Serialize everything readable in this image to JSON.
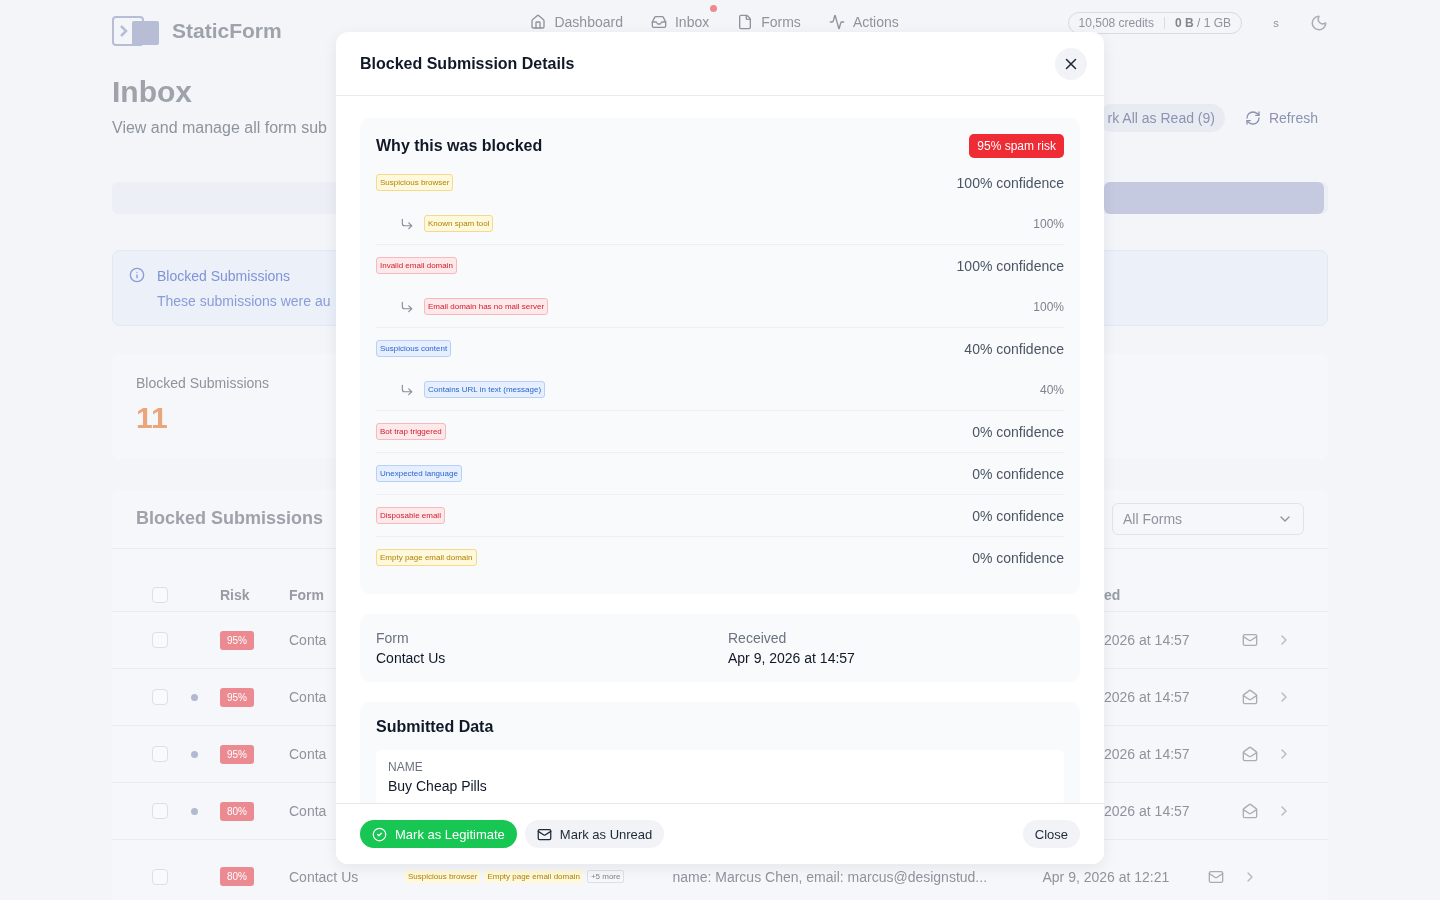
{
  "header": {
    "logo": "StaticForm",
    "nav": [
      {
        "label": "Dashboard",
        "dot": false
      },
      {
        "label": "Inbox",
        "dot": true
      },
      {
        "label": "Forms",
        "dot": false
      },
      {
        "label": "Actions",
        "dot": false
      }
    ],
    "credits": "10,508",
    "credits_label": "credits",
    "storage_used": "0 B",
    "storage_total": "/ 1 GB",
    "avatar": "s"
  },
  "page": {
    "title": "Inbox",
    "subtitle": "View and manage all form sub",
    "actions": [
      "rk All as Read (9)",
      "Refresh"
    ]
  },
  "alert": {
    "title": "Blocked Submissions",
    "text": "These submissions were au"
  },
  "stat": {
    "label": "Blocked Submissions",
    "value": "11"
  },
  "table": {
    "title": "Blocked Submissions",
    "filter": "All Forms",
    "columns": [
      "Risk",
      "Form",
      "ed"
    ],
    "all_checked": false,
    "rows": [
      {
        "checked": false,
        "unread": false,
        "risk": "95%",
        "form": "Conta",
        "received": "2026 at 14:57"
      },
      {
        "checked": false,
        "unread": true,
        "risk": "95%",
        "form": "Conta",
        "received": "2026 at 14:57"
      },
      {
        "checked": false,
        "unread": true,
        "risk": "95%",
        "form": "Conta",
        "received": "2026 at 14:57"
      },
      {
        "checked": false,
        "unread": true,
        "risk": "80%",
        "form": "Conta",
        "received": "2026 at 14:57"
      }
    ],
    "last_row": {
      "checked": false,
      "unread": false,
      "risk": "80%",
      "form": "Contact Us",
      "tags": [
        {
          "label": "Suspicious browser",
          "kind": "warning"
        },
        {
          "label": "Empty page email domain",
          "kind": "warning"
        }
      ],
      "more": "+5 more",
      "preview": "name: Marcus Chen, email: marcus@designstud...",
      "received": "Apr 9, 2026 at 12:21"
    }
  },
  "modal": {
    "title": "Blocked Submission Details",
    "reasons_title": "Why this was blocked",
    "risk": "95% spam risk",
    "reasons": [
      {
        "label": "Suspicious browser",
        "kind": "warning",
        "confidence": "100% confidence",
        "children": [
          {
            "label": "Known spam tool",
            "kind": "warning",
            "confidence": "100%"
          }
        ]
      },
      {
        "label": "Invalid email domain",
        "kind": "danger",
        "confidence": "100% confidence",
        "children": [
          {
            "label": "Email domain has no mail server",
            "kind": "danger",
            "confidence": "100%"
          }
        ]
      },
      {
        "label": "Suspicious content",
        "kind": "info",
        "confidence": "40% confidence",
        "children": [
          {
            "label": "Contains URL in text (message)",
            "kind": "info",
            "confidence": "40%"
          }
        ]
      },
      {
        "label": "Bot trap triggered",
        "kind": "danger",
        "confidence": "0% confidence"
      },
      {
        "label": "Unexpected language",
        "kind": "info",
        "confidence": "0% confidence"
      },
      {
        "label": "Disposable email",
        "kind": "danger",
        "confidence": "0% confidence"
      },
      {
        "label": "Empty page email domain",
        "kind": "warning",
        "confidence": "0% confidence"
      }
    ],
    "meta": [
      {
        "label": "Form",
        "value": "Contact Us"
      },
      {
        "label": "Received",
        "value": "Apr 9, 2026 at 14:57"
      }
    ],
    "data_title": "Submitted Data",
    "fields": [
      {
        "label": "NAME",
        "value": "Buy Cheap Pills"
      }
    ],
    "buttons": [
      {
        "label": "Mark as Legitimate",
        "kind": "primary"
      },
      {
        "label": "Mark as Unread",
        "kind": "secondary"
      },
      {
        "label": "Close",
        "kind": "plain"
      }
    ]
  }
}
